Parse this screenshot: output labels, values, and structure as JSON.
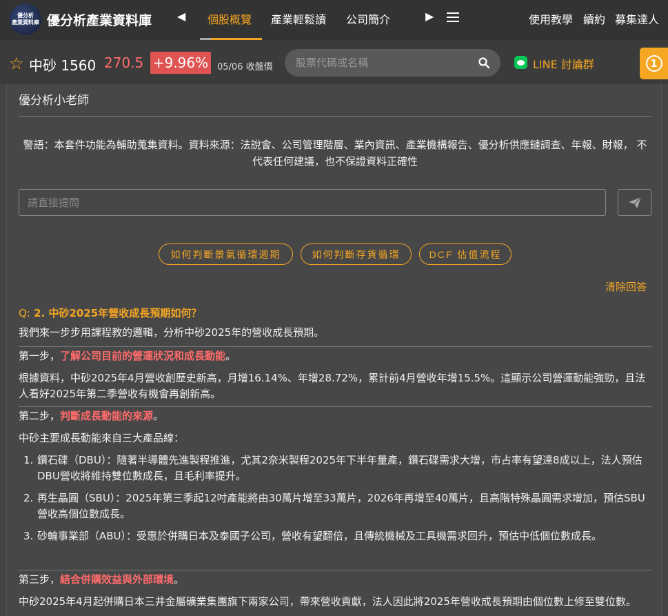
{
  "nav": {
    "logo_line1": "優分析",
    "logo_line2": "產業資料庫",
    "brand": "優分析產業資料庫",
    "tabs": [
      {
        "label": "個股概覽",
        "active": true
      },
      {
        "label": "產業輕鬆讀",
        "active": false
      },
      {
        "label": "公司簡介",
        "active": false
      }
    ],
    "right_links": [
      "使用教學",
      "續約",
      "募集達人"
    ]
  },
  "stock": {
    "name": "中砂 1560",
    "price": "270.5",
    "change": "+9.96%",
    "close_label": "05/06 收盤價",
    "search_placeholder": "股票代碼或名稱",
    "line_label": "LINE 討論群",
    "badge": "1"
  },
  "panel": {
    "title": "優分析小老師",
    "warning": "警語：本套件功能為輔助蒐集資料。資料來源：法說會、公司管理階層、業內資訊、產業機構報告、優分析供應鏈調查、年報、財報， 不代表任何建議，也不保證資料正確性",
    "ask_placeholder": "請直接提問",
    "chips": [
      "如何判斷景氣循環週期",
      "如何判斷存貨循環",
      "DCF 估值流程"
    ],
    "clear_label": "清除回答"
  },
  "answer": {
    "q_prefix": "Q:",
    "question": "2. 中砂2025年營收成長預期如何？",
    "intro": "我們來一步步用課程教的邏輯，分析中砂2025年的營收成長預期。",
    "step1_prefix": "第一步，",
    "step1_highlight": "了解公司目前的營運狀況和成長動能",
    "step1_suffix": "。",
    "step1_body": "根據資料，中砂2025年4月營收創歷史新高，月增16.14%、年增28.72%，累計前4月營收年增15.5%。這顯示公司營運動能強勁，且法人看好2025年第二季營收有機會再創新高。",
    "step2_prefix": "第二步，",
    "step2_highlight": "判斷成長動能的來源",
    "step2_suffix": "。",
    "step2_body": "中砂主要成長動能來自三大產品線：",
    "items": [
      {
        "num": "1.",
        "text": "鑽石碟（DBU）：隨著半導體先進製程推進，尤其2奈米製程2025年下半年量產，鑽石碟需求大增，市占率有望達8成以上，法人預估DBU營收將維持雙位數成長，且毛利率提升。"
      },
      {
        "num": "2.",
        "text": "再生晶圓（SBU）：2025年第三季起12吋產能將由30萬片增至33萬片，2026年再增至40萬片，且高階特殊晶圓需求增加，預估SBU營收高個位數成長。"
      },
      {
        "num": "3.",
        "text": "砂輪事業部（ABU）：受惠於併購日本及泰國子公司，營收有望翻倍，且傳統機械及工具機需求回升，預估中低個位數成長。"
      }
    ],
    "step3_prefix": "第三步，",
    "step3_highlight": "結合併購效益與外部環境",
    "step3_suffix": "。",
    "step3_body": "中砂2025年4月起併購日本三井金屬礦業集團旗下兩家公司，帶來營收貢獻，法人因此將2025年營收成長預期由個位數上修至雙位數。"
  },
  "colors": {
    "accent": "#f5a623",
    "up": "#e05353",
    "highlight": "#ff6b6b",
    "line": "#06c755"
  }
}
